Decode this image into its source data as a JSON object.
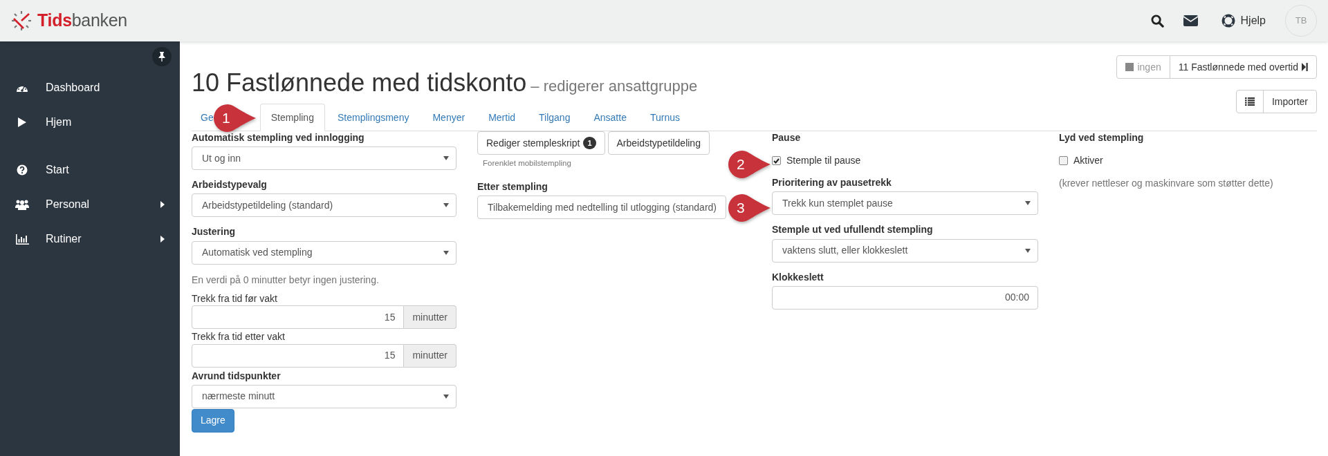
{
  "header": {
    "logo_bold": "Tids",
    "logo_rest": "banken",
    "help": "Hjelp",
    "avatar": "TB"
  },
  "sidebar": {
    "groups": [
      [
        {
          "label": "Dashboard",
          "has_submenu": false
        },
        {
          "label": "Hjem",
          "has_submenu": false
        }
      ],
      [
        {
          "label": "Start",
          "has_submenu": false
        },
        {
          "label": "Personal",
          "has_submenu": true
        },
        {
          "label": "Rutiner",
          "has_submenu": true
        }
      ]
    ]
  },
  "page": {
    "title": "10 Fastlønnede med tidskonto",
    "subtitle": "– redigerer ansattgruppe",
    "prev": {
      "label": "ingen",
      "disabled": true
    },
    "next": {
      "label": "11 Fastlønnede med overtid",
      "disabled": false
    },
    "import": "Importer"
  },
  "tabs": [
    {
      "label": "Ge",
      "selected": false
    },
    {
      "label": "Stempling",
      "selected": true
    },
    {
      "label": "Stemplingsmeny",
      "selected": false
    },
    {
      "label": "Menyer",
      "selected": false
    },
    {
      "label": "Mertid",
      "selected": false
    },
    {
      "label": "Tilgang",
      "selected": false
    },
    {
      "label": "Ansatte",
      "selected": false
    },
    {
      "label": "Turnus",
      "selected": false
    }
  ],
  "columns": [
    [
      {
        "kind": "select",
        "label": "Automatisk stempling ved innlogging",
        "value": "Ut og inn"
      },
      {
        "kind": "select",
        "label": "Arbeidstypevalg",
        "value": "Arbeidstypetildeling (standard)"
      },
      {
        "kind": "select",
        "label": "Justering",
        "value": "Automatisk ved stempling"
      },
      {
        "kind": "help",
        "text": "En verdi på 0 minutter betyr ingen justering."
      },
      {
        "kind": "addon",
        "label": "Trekk fra tid før vakt",
        "value": "15",
        "addon": "minutter"
      },
      {
        "kind": "addon",
        "label": "Trekk fra tid etter vakt",
        "value": "15",
        "addon": "minutter"
      },
      {
        "kind": "select",
        "label": "Avrund tidspunkter",
        "value": "nærmeste minutt"
      },
      {
        "kind": "submit",
        "label": "Lagre"
      }
    ],
    [
      {
        "kind": "buttons",
        "buttons": [
          {
            "label": "Rediger stempleskript",
            "badge": "1"
          },
          {
            "label": "Arbeidstypetildeling"
          }
        ]
      },
      {
        "kind": "small",
        "text": "Forenklet mobilstempling"
      },
      {
        "kind": "select",
        "label": "Etter stempling",
        "value": "Tilbakemelding med nedtelling til utlogging (standard)"
      }
    ],
    [
      {
        "kind": "heading",
        "text": "Pause"
      },
      {
        "kind": "checkbox",
        "label": "Stemple til pause",
        "checked": true
      },
      {
        "kind": "select",
        "label": "Prioritering av pausetrekk",
        "value": "Trekk kun stemplet pause"
      },
      {
        "kind": "select",
        "label": "Stemple ut ved ufullendt stempling",
        "value": "vaktens slutt, eller klokkeslett"
      },
      {
        "kind": "text",
        "label": "Klokkeslett",
        "value": "00:00"
      }
    ],
    [
      {
        "kind": "heading",
        "text": "Lyd ved stempling"
      },
      {
        "kind": "checkbox",
        "label": "Aktiver",
        "checked": false
      },
      {
        "kind": "help",
        "text": "(krever nettleser og maskinvare som støtter dette)"
      }
    ]
  ],
  "callouts": [
    "1",
    "2",
    "3"
  ]
}
